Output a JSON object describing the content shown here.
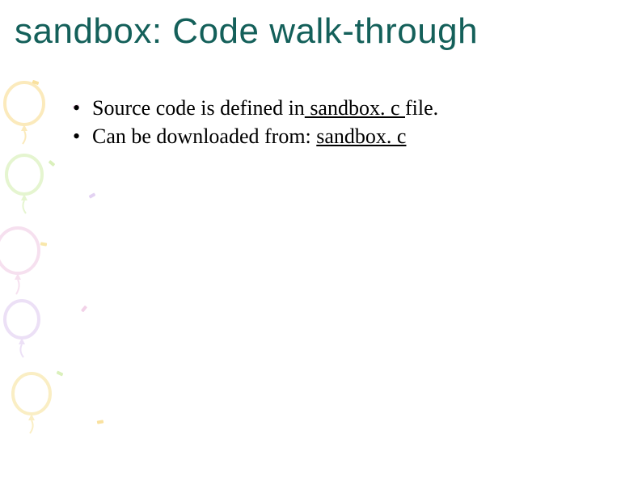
{
  "title": "sandbox: Code walk-through",
  "bullets": [
    {
      "pre": "Source code is defined in",
      "link": " sandbox. c ",
      "post": "file."
    },
    {
      "pre": "Can be downloaded from: ",
      "link": "sandbox. c",
      "post": ""
    }
  ]
}
